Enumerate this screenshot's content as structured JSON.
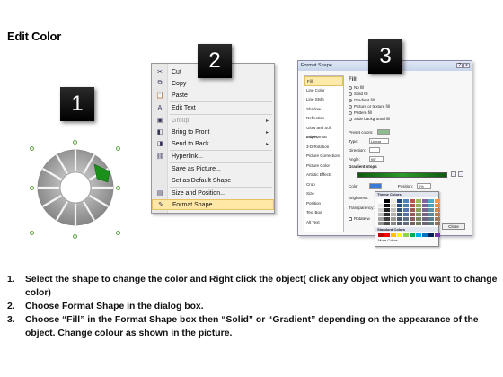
{
  "title": "Edit Color",
  "step_numbers": [
    "1",
    "2",
    "3"
  ],
  "context_menu": {
    "items": [
      {
        "label": "Cut",
        "icon": "scissors-icon",
        "glyph": "✂",
        "disabled": false,
        "submenu": false
      },
      {
        "label": "Copy",
        "icon": "copy-icon",
        "glyph": "⧉",
        "disabled": false,
        "submenu": false
      },
      {
        "label": "Paste",
        "icon": "paste-icon",
        "glyph": "📋",
        "disabled": false,
        "submenu": false
      },
      {
        "label": "Edit Text",
        "icon": "edit-text-icon",
        "glyph": "A",
        "disabled": false,
        "submenu": false
      },
      {
        "label": "Group",
        "icon": "group-icon",
        "glyph": "▣",
        "disabled": true,
        "submenu": true
      },
      {
        "label": "Bring to Front",
        "icon": "bring-front-icon",
        "glyph": "◧",
        "disabled": false,
        "submenu": true
      },
      {
        "label": "Send to Back",
        "icon": "send-back-icon",
        "glyph": "◨",
        "disabled": false,
        "submenu": true
      },
      {
        "label": "Hyperlink...",
        "icon": "hyperlink-icon",
        "glyph": "⛓",
        "disabled": false,
        "submenu": false
      },
      {
        "label": "Save as Picture...",
        "icon": "",
        "glyph": "",
        "disabled": false,
        "submenu": false
      },
      {
        "label": "Set as Default Shape",
        "icon": "",
        "glyph": "",
        "disabled": false,
        "submenu": false
      },
      {
        "label": "Size and Position...",
        "icon": "size-icon",
        "glyph": "▤",
        "disabled": false,
        "submenu": false
      },
      {
        "label": "Format Shape...",
        "icon": "format-shape-icon",
        "glyph": "✎",
        "disabled": false,
        "submenu": false,
        "highlighted": true
      }
    ]
  },
  "dialog": {
    "title": "Format Shape",
    "categories": [
      "Fill",
      "Line Color",
      "Line Style",
      "Shadow",
      "Reflection",
      "Glow and Soft Edges",
      "3-D Format",
      "3-D Rotation",
      "Picture Corrections",
      "Picture Color",
      "Artistic Effects",
      "Crop",
      "Size",
      "Position",
      "Text Box",
      "Alt Text"
    ],
    "selected_category": "Fill",
    "fill_heading": "Fill",
    "fill_options": [
      "No fill",
      "Solid fill",
      "Gradient fill",
      "Picture or texture fill",
      "Pattern fill",
      "Slide background fill"
    ],
    "selected_fill": "Gradient fill",
    "preset_colors_label": "Preset colors:",
    "type_label": "Type:",
    "type_value": "Linear",
    "direction_label": "Direction:",
    "angle_label": "Angle:",
    "angle_value": "90°",
    "gradient_stops_label": "Gradient stops",
    "color_label": "Color",
    "position_label": "Position:",
    "position_value": "0%",
    "brightness_label": "Brightness:",
    "transparency_label": "Transparency:",
    "rotate_label": "Rotate w",
    "close_label": "Close"
  },
  "palette": {
    "theme_label": "Theme Colors",
    "standard_label": "Standard Colors",
    "more_label": "More Colors...",
    "theme_colors": [
      "#ffffff",
      "#000000",
      "#eeece1",
      "#1f497d",
      "#4f81bd",
      "#c0504d",
      "#9bbb59",
      "#8064a2",
      "#4bacc6",
      "#f79646"
    ],
    "standard_colors": [
      "#c00000",
      "#ff0000",
      "#ffc000",
      "#ffff00",
      "#92d050",
      "#00b050",
      "#00b0f0",
      "#0070c0",
      "#002060",
      "#7030a0"
    ]
  },
  "instructions": [
    {
      "num": "1.",
      "text": "Select the shape to change the color and Right click the object( click any object which you want to change color)"
    },
    {
      "num": "2.",
      "text": "Choose Format Shape in the dialog box."
    },
    {
      "num": "3.",
      "text": "Choose “Fill” in the Format Shape box then “Solid” or “Gradient” depending on the appearance of the object. Change colour as shown in the picture."
    }
  ],
  "colors": {
    "accent_green": "#1a8f1a",
    "highlight": "#ffe8a6",
    "ring_gray": "#9a9a9a"
  }
}
